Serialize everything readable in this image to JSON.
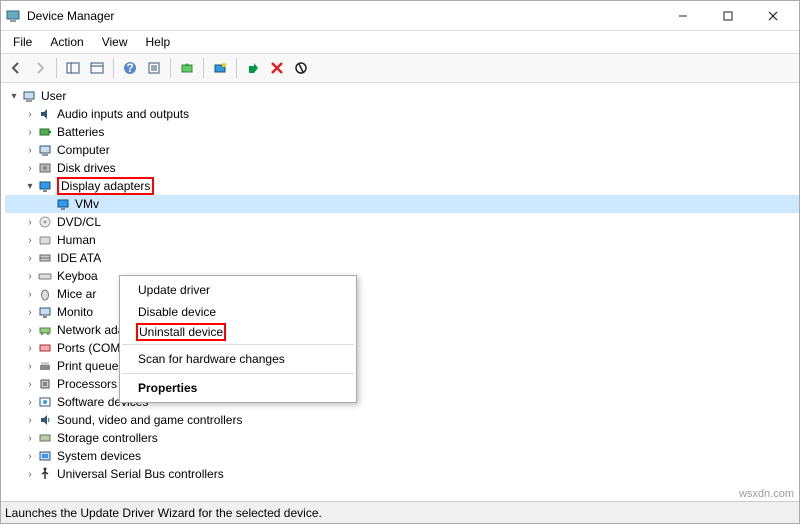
{
  "window": {
    "title": "Device Manager"
  },
  "menubar": [
    "File",
    "Action",
    "View",
    "Help"
  ],
  "tree": {
    "root": "User",
    "nodes": [
      {
        "label": "Audio inputs and outputs",
        "icon": "audio-icon"
      },
      {
        "label": "Batteries",
        "icon": "battery-icon"
      },
      {
        "label": "Computer",
        "icon": "computer-icon"
      },
      {
        "label": "Disk drives",
        "icon": "disk-icon"
      },
      {
        "label": "Display adapters",
        "icon": "display-icon",
        "expanded": true,
        "highlighted": true,
        "children": [
          {
            "label": "VMv",
            "icon": "display-icon",
            "selected": true
          }
        ]
      },
      {
        "label": "DVD/CL",
        "icon": "dvd-icon"
      },
      {
        "label": "Human",
        "icon": "hid-icon"
      },
      {
        "label": "IDE ATA",
        "icon": "ide-icon"
      },
      {
        "label": "Keyboa",
        "icon": "keyboard-icon"
      },
      {
        "label": "Mice ar",
        "icon": "mouse-icon"
      },
      {
        "label": "Monito",
        "icon": "monitor-icon"
      },
      {
        "label": "Network adapters",
        "icon": "network-icon"
      },
      {
        "label": "Ports (COM & LPT)",
        "icon": "ports-icon"
      },
      {
        "label": "Print queues",
        "icon": "printer-icon"
      },
      {
        "label": "Processors",
        "icon": "cpu-icon"
      },
      {
        "label": "Software devices",
        "icon": "software-icon"
      },
      {
        "label": "Sound, video and game controllers",
        "icon": "sound-icon"
      },
      {
        "label": "Storage controllers",
        "icon": "storage-icon"
      },
      {
        "label": "System devices",
        "icon": "system-icon"
      },
      {
        "label": "Universal Serial Bus controllers",
        "icon": "usb-icon"
      }
    ]
  },
  "context_menu": {
    "items": [
      "Update driver",
      "Disable device",
      "Uninstall device",
      "__sep__",
      "Scan for hardware changes",
      "__sep__",
      "Properties"
    ],
    "highlighted": "Uninstall device",
    "bold": "Properties"
  },
  "statusbar": "Launches the Update Driver Wizard for the selected device.",
  "watermark": "wsxdn.com"
}
